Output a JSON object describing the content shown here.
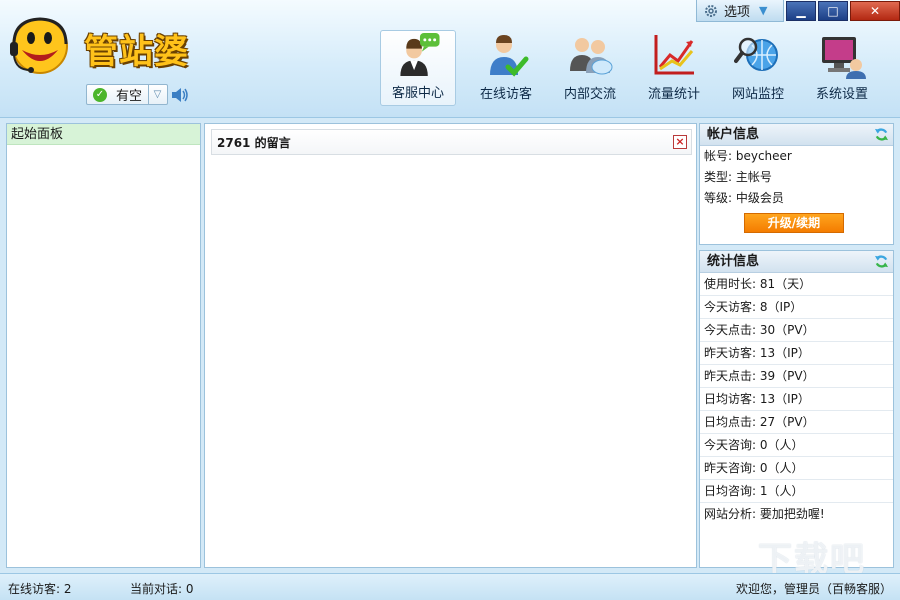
{
  "window": {
    "options_label": "选项",
    "minimize_glyph": "▁",
    "maximize_glyph": "□",
    "close_glyph": "✕"
  },
  "brand": {
    "name": "管站婆",
    "status": "有空"
  },
  "nav": [
    {
      "label": "客服中心",
      "icon": "customer-service-icon",
      "active": true
    },
    {
      "label": "在线访客",
      "icon": "online-visitor-icon",
      "active": false
    },
    {
      "label": "内部交流",
      "icon": "internal-chat-icon",
      "active": false
    },
    {
      "label": "流量统计",
      "icon": "traffic-stats-icon",
      "active": false
    },
    {
      "label": "网站监控",
      "icon": "site-monitor-icon",
      "active": false
    },
    {
      "label": "系统设置",
      "icon": "system-settings-icon",
      "active": false
    }
  ],
  "left_panel": {
    "items": [
      "起始面板"
    ]
  },
  "center": {
    "tab_title": "2761 的留言",
    "tab_close": "×"
  },
  "account": {
    "title": "帐户信息",
    "rows": [
      "帐号: beycheer",
      "类型: 主帐号",
      "等级: 中级会员"
    ],
    "upgrade_label": "升级/续期"
  },
  "stats": {
    "title": "统计信息",
    "rows": [
      "使用时长: 81（天）",
      "今天访客: 8（IP）",
      "今天点击: 30（PV）",
      "昨天访客: 13（IP）",
      "昨天点击: 39（PV）",
      "日均访客: 13（IP）",
      "日均点击: 27（PV）",
      "今天咨询: 0（人）",
      "昨天咨询: 0（人）",
      "日均咨询: 1（人）",
      "网站分析: 要加把劲喔!"
    ]
  },
  "footer": {
    "online_visitors": "在线访客: 2",
    "current_dialogs": "当前对话: 0",
    "welcome": "欢迎您，管理员（百畅客服）"
  },
  "watermark": "下载吧",
  "colors": {
    "accent": "#f47c00",
    "header_bg": "#d6ecfa",
    "selected_item": "#d7f3d7"
  }
}
